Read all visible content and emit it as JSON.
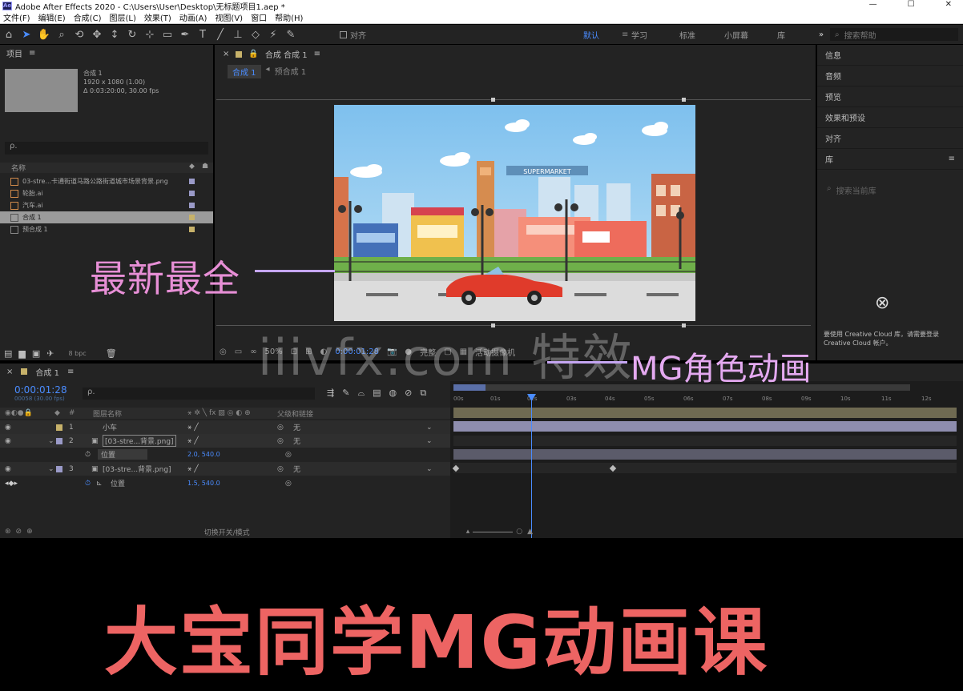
{
  "window": {
    "title": "Adobe After Effects 2020 - C:\\Users\\User\\Desktop\\无标题项目1.aep *",
    "app_icon": "Ae",
    "controls": [
      "—",
      "☐",
      "✕"
    ]
  },
  "menu": [
    "文件(F)",
    "编辑(E)",
    "合成(C)",
    "图层(L)",
    "效果(T)",
    "动画(A)",
    "视图(V)",
    "窗口",
    "帮助(H)"
  ],
  "toolbar": {
    "snap_label": "对齐",
    "workspaces": [
      "默认",
      "学习",
      "标准",
      "小屏幕",
      "库"
    ],
    "search_placeholder": "搜索帮助"
  },
  "project": {
    "title": "项目",
    "comp_name": "合成 1",
    "comp_info": [
      "1920 x 1080 (1.00)",
      "Δ 0:03:20:00, 30.00 fps"
    ],
    "search_placeholder": "ρ.",
    "col_name": "名称",
    "items": [
      {
        "name": "03-stre...卡通街道马路公路街道城市场景背景.png",
        "chip": "#9a9ac8",
        "selected": false
      },
      {
        "name": "轮胎.ai",
        "chip": "#9a9ac8",
        "selected": false
      },
      {
        "name": "汽车.ai",
        "chip": "#9a9ac8",
        "selected": false
      },
      {
        "name": "合成 1",
        "chip": "#c7b26a",
        "selected": true
      },
      {
        "name": "预合成 1",
        "chip": "#c7b26a",
        "selected": false
      }
    ],
    "footer_bpc": "8 bpc"
  },
  "composition": {
    "tab": "合成 合成 1",
    "sub_tabs": [
      "合成 1",
      "预合成 1"
    ],
    "zoom": "50%",
    "timecode": "0:00:01:28",
    "camera": "活动摄像机",
    "view": "完整"
  },
  "scene": {
    "sign": "SUPERMARKET"
  },
  "right_panel": {
    "items": [
      "信息",
      "音频",
      "预览",
      "效果和预设",
      "对齐",
      "库"
    ],
    "search_placeholder": "搜索当前库",
    "cc_text": "要使用 Creative Cloud 库，请需要登录 Creative Cloud 帐户。"
  },
  "timeline": {
    "tab": "合成 1",
    "time": "0:00:01:28",
    "fps": "00058 (30.00 fps)",
    "search_placeholder": "ρ.",
    "col_layer_name": "图层名称",
    "col_parent": "父级和链接",
    "layers": [
      {
        "num": "1",
        "name": "小车",
        "chip": "#c7b26a",
        "mode": "无"
      },
      {
        "num": "2",
        "name": "[03-stre...背景.png]",
        "chip": "#9a9ac8",
        "mode": "无"
      },
      {
        "num": "",
        "name": "位置",
        "chip": "",
        "mode": "",
        "value": "2.0, 540.0"
      },
      {
        "num": "3",
        "name": "[03-stre...背景.png]",
        "chip": "#9a9ac8",
        "mode": "无"
      },
      {
        "num": "",
        "name": "位置",
        "chip": "",
        "mode": "",
        "value": "1.5, 540.0"
      }
    ],
    "ruler": [
      "00s",
      "01s",
      "02s",
      "03s",
      "04s",
      "05s",
      "06s",
      "07s",
      "08s",
      "09s",
      "10s",
      "11s",
      "12s"
    ],
    "footer": "切换开关/模式"
  },
  "overlays": {
    "left_caption": "最新最全",
    "watermark": "iiivfx.com 特效",
    "right_caption": "MG角色动画",
    "banner": "大宝同学MG动画课"
  },
  "colors": {
    "accent_blue": "#4a8cff",
    "banner_red": "#ed6463",
    "caption_pink": "#e78fd6",
    "car_red": "#e03b2b"
  }
}
